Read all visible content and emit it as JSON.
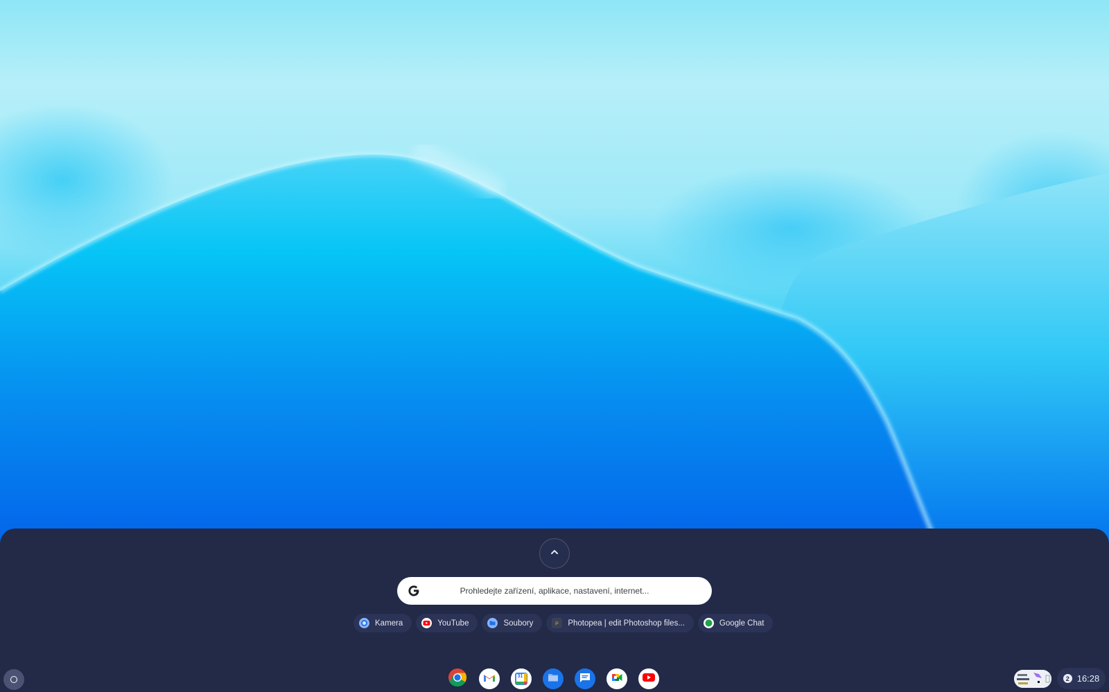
{
  "wallpaper": {
    "colors": {
      "top": "#b4eef9",
      "mid": "#00c4f4",
      "bottom": "#0446e6"
    }
  },
  "launcher": {
    "expand_button": {
      "icon": "chevron-up-icon"
    },
    "search": {
      "logo": "google-g-icon",
      "placeholder": "Prohledejte zařízení, aplikace, nastavení, internet..."
    },
    "suggestions": [
      {
        "label": "Kamera",
        "icon": "camera-icon"
      },
      {
        "label": "YouTube",
        "icon": "youtube-icon"
      },
      {
        "label": "Soubory",
        "icon": "files-icon"
      },
      {
        "label": "Photopea | edit Photoshop files...",
        "icon": "photopea-icon"
      },
      {
        "label": "Google Chat",
        "icon": "google-chat-icon"
      }
    ]
  },
  "shelf": {
    "launcher_icon": "launcher-circle-icon",
    "pinned_apps": [
      {
        "name": "Chrome",
        "icon": "chrome-icon"
      },
      {
        "name": "Gmail",
        "icon": "gmail-icon"
      },
      {
        "name": "Calendar",
        "icon": "calendar-icon"
      },
      {
        "name": "Files",
        "icon": "files-icon"
      },
      {
        "name": "Messages",
        "icon": "messages-icon"
      },
      {
        "name": "Meet",
        "icon": "meet-icon"
      },
      {
        "name": "YouTube",
        "icon": "youtube-icon"
      }
    ],
    "calendar_day": "31",
    "status": {
      "notification_count": "2",
      "time": "16:28"
    }
  },
  "colors": {
    "launcher_bg": "#222a48",
    "chip_bg": "#2b3356",
    "search_bg": "#ffffff"
  }
}
